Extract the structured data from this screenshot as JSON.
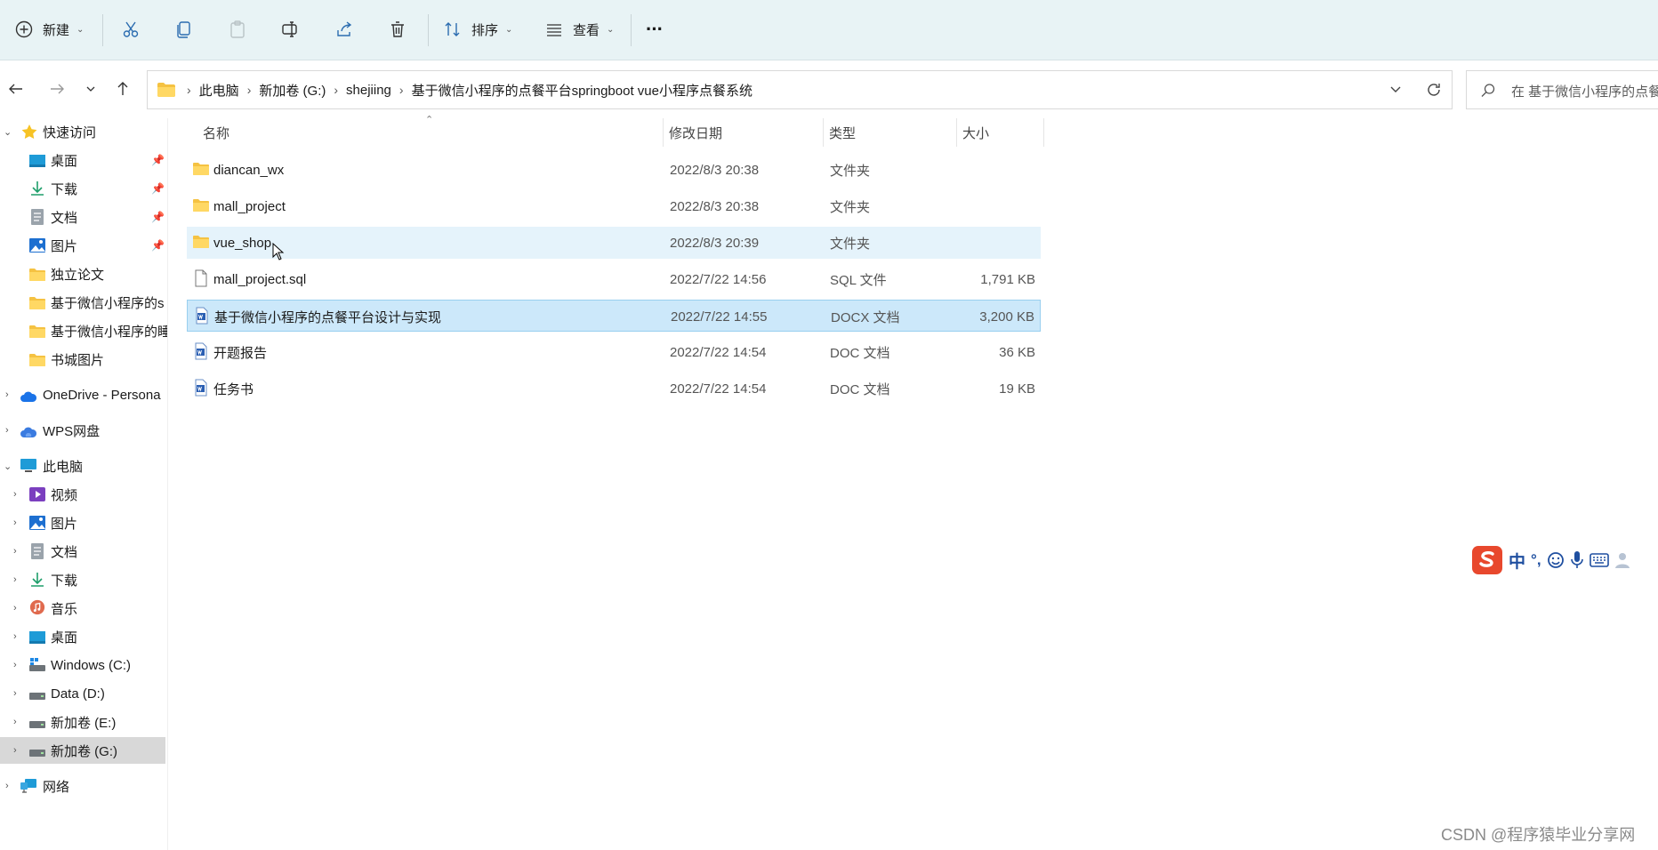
{
  "toolbar": {
    "new_label": "新建",
    "sort_label": "排序",
    "view_label": "查看",
    "more_label": "···"
  },
  "address": {
    "crumbs": [
      "此电脑",
      "新加卷 (G:)",
      "shejiing",
      "基于微信小程序的点餐平台springboot vue小程序点餐系统"
    ],
    "search_placeholder": "在 基于微信小程序的点餐"
  },
  "sidebar": {
    "quick_access": "快速访问",
    "quick_items": [
      "桌面",
      "下载",
      "文档",
      "图片",
      "独立论文",
      "基于微信小程序的s",
      "基于微信小程序的睡",
      "书城图片"
    ],
    "onedrive": "OneDrive - Persona",
    "wps": "WPS网盘",
    "this_pc": "此电脑",
    "pc_items": [
      "视频",
      "图片",
      "文档",
      "下载",
      "音乐",
      "桌面",
      "Windows (C:)",
      "Data (D:)",
      "新加卷 (E:)",
      "新加卷 (G:)"
    ],
    "network": "网络"
  },
  "columns": {
    "name": "名称",
    "date": "修改日期",
    "type": "类型",
    "size": "大小"
  },
  "files": [
    {
      "name": "diancan_wx",
      "date": "2022/8/3 20:38",
      "type": "文件夹",
      "size": "",
      "icon": "folder-icon"
    },
    {
      "name": "mall_project",
      "date": "2022/8/3 20:38",
      "type": "文件夹",
      "size": "",
      "icon": "folder-icon"
    },
    {
      "name": "vue_shop",
      "date": "2022/8/3 20:39",
      "type": "文件夹",
      "size": "",
      "icon": "folder-icon"
    },
    {
      "name": "mall_project.sql",
      "date": "2022/7/22 14:56",
      "type": "SQL 文件",
      "size": "1,791 KB",
      "icon": "file-icon"
    },
    {
      "name": "基于微信小程序的点餐平台设计与实现",
      "date": "2022/7/22 14:55",
      "type": "DOCX 文档",
      "size": "3,200 KB",
      "icon": "word-doc-icon"
    },
    {
      "name": "开题报告",
      "date": "2022/7/22 14:54",
      "type": "DOC 文档",
      "size": "36 KB",
      "icon": "word-doc-icon"
    },
    {
      "name": "任务书",
      "date": "2022/7/22 14:54",
      "type": "DOC 文档",
      "size": "19 KB",
      "icon": "word-doc-icon"
    }
  ],
  "ime": {
    "mode": "中",
    "punct": "°,"
  },
  "watermark": "CSDN @程序猿毕业分享网"
}
